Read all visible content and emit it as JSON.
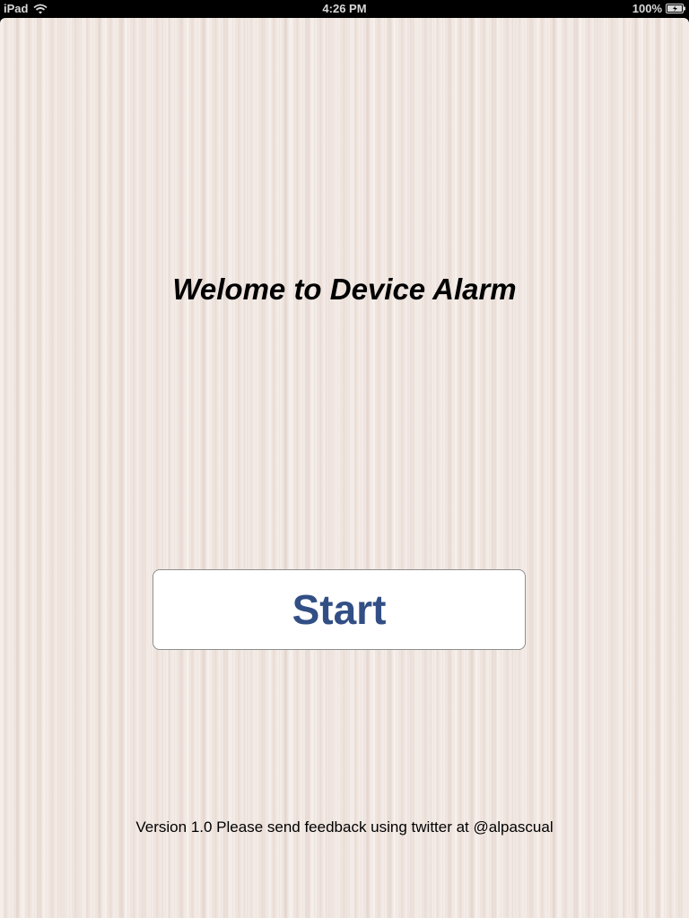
{
  "status_bar": {
    "device": "iPad",
    "time": "4:26 PM",
    "battery": "100%",
    "wifi_icon": "wifi-icon",
    "battery_icon": "battery-charging-icon"
  },
  "main": {
    "title": "Welome to Device Alarm",
    "start_label": "Start",
    "footer": "Version 1.0 Please send feedback using twitter at @alpascual"
  },
  "colors": {
    "button_text": "#324f85",
    "background": "#efe4de"
  }
}
